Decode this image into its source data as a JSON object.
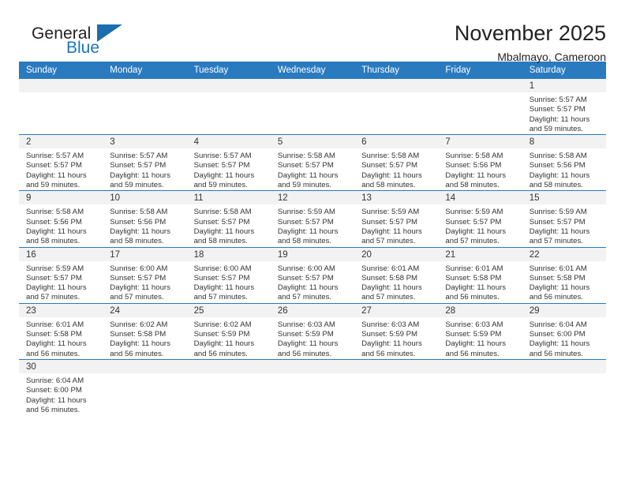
{
  "brand": {
    "name_part1": "General",
    "name_part2": "Blue",
    "triangle_color": "#1c6cb0"
  },
  "header": {
    "title": "November 2025",
    "subtitle": "Mbalmayo, Cameroon"
  },
  "theme": {
    "header_blue": "#2a7ac0",
    "daynum_band": "#f2f2f2",
    "text": "#333333"
  },
  "weekdays": [
    "Sunday",
    "Monday",
    "Tuesday",
    "Wednesday",
    "Thursday",
    "Friday",
    "Saturday"
  ],
  "weeks": [
    [
      {
        "blank": true
      },
      {
        "blank": true
      },
      {
        "blank": true
      },
      {
        "blank": true
      },
      {
        "blank": true
      },
      {
        "blank": true
      },
      {
        "day": "1",
        "sunrise": "Sunrise: 5:57 AM",
        "sunset": "Sunset: 5:57 PM",
        "daylight1": "Daylight: 11 hours",
        "daylight2": "and 59 minutes."
      }
    ],
    [
      {
        "day": "2",
        "sunrise": "Sunrise: 5:57 AM",
        "sunset": "Sunset: 5:57 PM",
        "daylight1": "Daylight: 11 hours",
        "daylight2": "and 59 minutes."
      },
      {
        "day": "3",
        "sunrise": "Sunrise: 5:57 AM",
        "sunset": "Sunset: 5:57 PM",
        "daylight1": "Daylight: 11 hours",
        "daylight2": "and 59 minutes."
      },
      {
        "day": "4",
        "sunrise": "Sunrise: 5:57 AM",
        "sunset": "Sunset: 5:57 PM",
        "daylight1": "Daylight: 11 hours",
        "daylight2": "and 59 minutes."
      },
      {
        "day": "5",
        "sunrise": "Sunrise: 5:58 AM",
        "sunset": "Sunset: 5:57 PM",
        "daylight1": "Daylight: 11 hours",
        "daylight2": "and 59 minutes."
      },
      {
        "day": "6",
        "sunrise": "Sunrise: 5:58 AM",
        "sunset": "Sunset: 5:57 PM",
        "daylight1": "Daylight: 11 hours",
        "daylight2": "and 58 minutes."
      },
      {
        "day": "7",
        "sunrise": "Sunrise: 5:58 AM",
        "sunset": "Sunset: 5:56 PM",
        "daylight1": "Daylight: 11 hours",
        "daylight2": "and 58 minutes."
      },
      {
        "day": "8",
        "sunrise": "Sunrise: 5:58 AM",
        "sunset": "Sunset: 5:56 PM",
        "daylight1": "Daylight: 11 hours",
        "daylight2": "and 58 minutes."
      }
    ],
    [
      {
        "day": "9",
        "sunrise": "Sunrise: 5:58 AM",
        "sunset": "Sunset: 5:56 PM",
        "daylight1": "Daylight: 11 hours",
        "daylight2": "and 58 minutes."
      },
      {
        "day": "10",
        "sunrise": "Sunrise: 5:58 AM",
        "sunset": "Sunset: 5:56 PM",
        "daylight1": "Daylight: 11 hours",
        "daylight2": "and 58 minutes."
      },
      {
        "day": "11",
        "sunrise": "Sunrise: 5:58 AM",
        "sunset": "Sunset: 5:57 PM",
        "daylight1": "Daylight: 11 hours",
        "daylight2": "and 58 minutes."
      },
      {
        "day": "12",
        "sunrise": "Sunrise: 5:59 AM",
        "sunset": "Sunset: 5:57 PM",
        "daylight1": "Daylight: 11 hours",
        "daylight2": "and 58 minutes."
      },
      {
        "day": "13",
        "sunrise": "Sunrise: 5:59 AM",
        "sunset": "Sunset: 5:57 PM",
        "daylight1": "Daylight: 11 hours",
        "daylight2": "and 57 minutes."
      },
      {
        "day": "14",
        "sunrise": "Sunrise: 5:59 AM",
        "sunset": "Sunset: 5:57 PM",
        "daylight1": "Daylight: 11 hours",
        "daylight2": "and 57 minutes."
      },
      {
        "day": "15",
        "sunrise": "Sunrise: 5:59 AM",
        "sunset": "Sunset: 5:57 PM",
        "daylight1": "Daylight: 11 hours",
        "daylight2": "and 57 minutes."
      }
    ],
    [
      {
        "day": "16",
        "sunrise": "Sunrise: 5:59 AM",
        "sunset": "Sunset: 5:57 PM",
        "daylight1": "Daylight: 11 hours",
        "daylight2": "and 57 minutes."
      },
      {
        "day": "17",
        "sunrise": "Sunrise: 6:00 AM",
        "sunset": "Sunset: 5:57 PM",
        "daylight1": "Daylight: 11 hours",
        "daylight2": "and 57 minutes."
      },
      {
        "day": "18",
        "sunrise": "Sunrise: 6:00 AM",
        "sunset": "Sunset: 5:57 PM",
        "daylight1": "Daylight: 11 hours",
        "daylight2": "and 57 minutes."
      },
      {
        "day": "19",
        "sunrise": "Sunrise: 6:00 AM",
        "sunset": "Sunset: 5:57 PM",
        "daylight1": "Daylight: 11 hours",
        "daylight2": "and 57 minutes."
      },
      {
        "day": "20",
        "sunrise": "Sunrise: 6:01 AM",
        "sunset": "Sunset: 5:58 PM",
        "daylight1": "Daylight: 11 hours",
        "daylight2": "and 57 minutes."
      },
      {
        "day": "21",
        "sunrise": "Sunrise: 6:01 AM",
        "sunset": "Sunset: 5:58 PM",
        "daylight1": "Daylight: 11 hours",
        "daylight2": "and 56 minutes."
      },
      {
        "day": "22",
        "sunrise": "Sunrise: 6:01 AM",
        "sunset": "Sunset: 5:58 PM",
        "daylight1": "Daylight: 11 hours",
        "daylight2": "and 56 minutes."
      }
    ],
    [
      {
        "day": "23",
        "sunrise": "Sunrise: 6:01 AM",
        "sunset": "Sunset: 5:58 PM",
        "daylight1": "Daylight: 11 hours",
        "daylight2": "and 56 minutes."
      },
      {
        "day": "24",
        "sunrise": "Sunrise: 6:02 AM",
        "sunset": "Sunset: 5:58 PM",
        "daylight1": "Daylight: 11 hours",
        "daylight2": "and 56 minutes."
      },
      {
        "day": "25",
        "sunrise": "Sunrise: 6:02 AM",
        "sunset": "Sunset: 5:59 PM",
        "daylight1": "Daylight: 11 hours",
        "daylight2": "and 56 minutes."
      },
      {
        "day": "26",
        "sunrise": "Sunrise: 6:03 AM",
        "sunset": "Sunset: 5:59 PM",
        "daylight1": "Daylight: 11 hours",
        "daylight2": "and 56 minutes."
      },
      {
        "day": "27",
        "sunrise": "Sunrise: 6:03 AM",
        "sunset": "Sunset: 5:59 PM",
        "daylight1": "Daylight: 11 hours",
        "daylight2": "and 56 minutes."
      },
      {
        "day": "28",
        "sunrise": "Sunrise: 6:03 AM",
        "sunset": "Sunset: 5:59 PM",
        "daylight1": "Daylight: 11 hours",
        "daylight2": "and 56 minutes."
      },
      {
        "day": "29",
        "sunrise": "Sunrise: 6:04 AM",
        "sunset": "Sunset: 6:00 PM",
        "daylight1": "Daylight: 11 hours",
        "daylight2": "and 56 minutes."
      }
    ],
    [
      {
        "day": "30",
        "sunrise": "Sunrise: 6:04 AM",
        "sunset": "Sunset: 6:00 PM",
        "daylight1": "Daylight: 11 hours",
        "daylight2": "and 56 minutes."
      },
      {
        "blank": true
      },
      {
        "blank": true
      },
      {
        "blank": true
      },
      {
        "blank": true
      },
      {
        "blank": true
      },
      {
        "blank": true
      }
    ]
  ]
}
